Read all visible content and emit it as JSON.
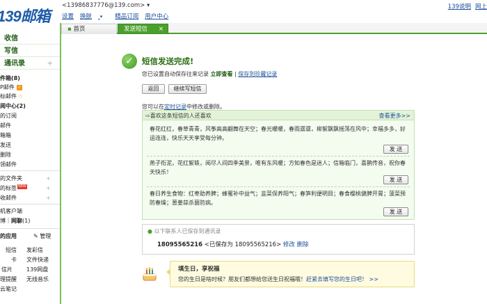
{
  "header": {
    "logo": "139邮箱",
    "account": "<13986837776@139.com>",
    "account_caret": "▾",
    "nav": [
      "设置",
      "换肤",
      "精品订阅",
      "用户中心"
    ],
    "nav_caret": "▾",
    "right_links": [
      "139说明",
      "网上"
    ]
  },
  "tabs": {
    "home": "首页",
    "sms": "发送短信",
    "close": "×"
  },
  "sidebar": {
    "receive": "收信",
    "compose": "写信",
    "contacts": "通讯录",
    "plus": "+",
    "inbox": "件箱(8)",
    "unread": "P邮件",
    "starred": "标邮件",
    "subscribe_center": "阅中心(2)",
    "my_subs": "的订阅",
    "items1": [
      "邮件",
      "箱箱",
      "发送",
      "删除",
      "领邮件"
    ],
    "my_folders": "的文件夹",
    "my_tags": "的标签",
    "new_badge": "NEW",
    "archived": "收邮件",
    "client": "机客户端",
    "im_pre": "博｜",
    "im": "网聊",
    "im_count": "(1)",
    "apps_title": "的应用",
    "manage": "管理",
    "apps": [
      [
        "短信",
        "发彩信"
      ],
      [
        "卡",
        "文件快递"
      ],
      [
        "信片",
        "139网盘"
      ],
      [
        "理提醒",
        "无线音乐"
      ],
      [
        "云笔记",
        ""
      ]
    ]
  },
  "main": {
    "done_title": "短信发送完成!",
    "saved_text": "您已设置自动保存往来记录",
    "view_now": "立即查看",
    "save_to_archive": "保存到珍藏记录",
    "back_btn": "返回",
    "continue_btn": "继续写短信",
    "modify_prefix": "您可以在",
    "modify_link": "定时记录",
    "modify_suffix": "中修改或删除。",
    "blessing": {
      "title": "⇨喜欢这条短信的人还喜欢",
      "more": "查看更多>>",
      "send_label": "发 送",
      "items": [
        "春花红红，春草青青，风筝高高翩舞在天空；春光暖暖，春雨潺潺，柳絮飘飘摇荡在风中；幸福多多，好运连连，快乐天天享受每分钟。",
        "燕子衔泥，花红絮轶，阅尽人间四季美景，唯有东风暖；方知春色是迷人；信箱临门，喜鹊传音，祝你春天快乐！",
        "春日养生食物：红枣助养脾；蜂蜜补中益气；韭菜保养阳气；春笋利便明目；春食樱桃健脾开胃；菠菜预防春燥；葱姜蒜杀菌防病。"
      ]
    },
    "contacts_saved": {
      "title": "以下联系人已保存到通讯录",
      "number": "18095565216",
      "saved_as": "<已保存为 18095565216>",
      "edit": "修改",
      "delete": "删除"
    },
    "birthday": {
      "title": "填生日，享祝福",
      "text": "您的生日是啥时候？朋友们都想给您送生日祝福哦！",
      "link": "赶紧去填写您的生日吧！",
      "arrow": ">>"
    }
  },
  "colors": {
    "brand": "#1e5ca8",
    "accent_green": "#4aa02c",
    "link": "#1c4f98"
  }
}
